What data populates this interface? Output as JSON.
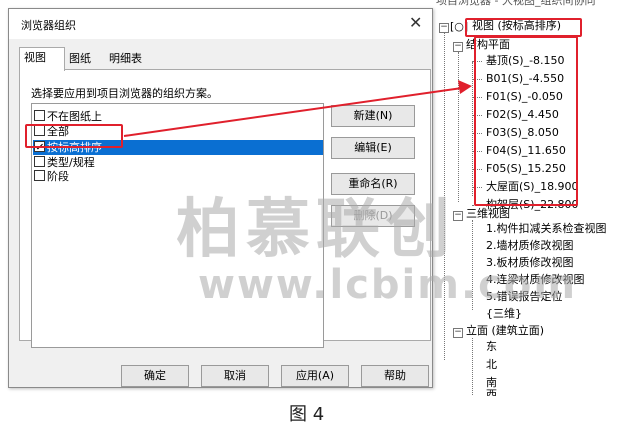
{
  "dialog": {
    "title": "浏览器组织",
    "close_glyph": "✕",
    "tabs": [
      "视图",
      "图纸",
      "明细表"
    ],
    "instruction": "选择要应用到项目浏览器的组织方案。",
    "schemes": [
      {
        "label": "不在图纸上",
        "checked": false
      },
      {
        "label": "全部",
        "checked": false
      },
      {
        "label": "按标高排序",
        "checked": true
      },
      {
        "label": "类型/规程",
        "checked": false
      },
      {
        "label": "阶段",
        "checked": false
      }
    ],
    "side_buttons": [
      "新建(N)",
      "编辑(E)",
      "重命名(R)",
      "删除(D)"
    ],
    "bottom_buttons": [
      "确定",
      "取消",
      "应用(A)",
      "帮助"
    ]
  },
  "tree": {
    "top_cut": "项目浏览器 - 大视图_组织间协同",
    "root": "视图 (按标高排序)",
    "group1": "结构平面",
    "levels": [
      "基顶(S)_-8.150",
      "B01(S)_-4.550",
      "F01(S)_-0.050",
      "F02(S)_4.450",
      "F03(S)_8.050",
      "F04(S)_11.650",
      "F05(S)_15.250",
      "大屋面(S)_18.900",
      "构架层(S)_22.800"
    ],
    "group2": "三维视图",
    "views3d": [
      "1.构件扣减关系检查视图",
      "2.墙材质修改视图",
      "3.板材质修改视图",
      "4.连梁材质修改视图",
      "5.错误报告定位",
      "{三维}"
    ],
    "group3": "立面 (建筑立面)",
    "elevations": [
      "东",
      "北",
      "南",
      "西"
    ]
  },
  "watermark": {
    "brand": "柏慕联创",
    "url": "www.lcbim.com"
  },
  "caption": "图 4",
  "colors": {
    "highlight": "#e0202c",
    "selection": "#0a6fd2",
    "watermark": "#c8c8c8"
  }
}
